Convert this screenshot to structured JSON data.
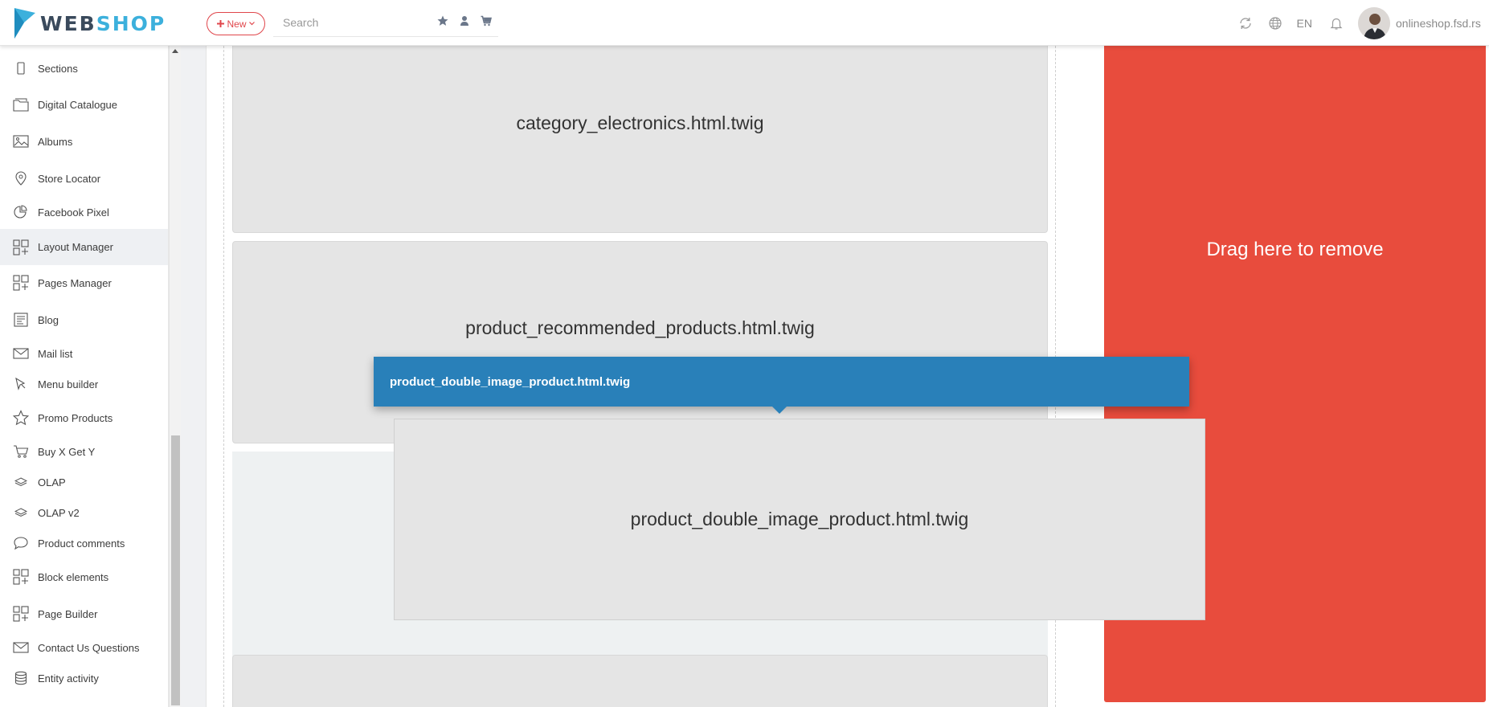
{
  "header": {
    "logo_web": "WEB",
    "logo_shop": "SHOP",
    "new_label": "New",
    "search_placeholder": "Search",
    "lang": "EN",
    "domain": "onlineshop.fsd.rs"
  },
  "sidebar": {
    "items": [
      {
        "label": "Sections",
        "icon": "mobile-icon"
      },
      {
        "label": "Digital Catalogue",
        "icon": "folder-icon"
      },
      {
        "label": "Albums",
        "icon": "image-icon"
      },
      {
        "label": "Store Locator",
        "icon": "map-pin-icon"
      },
      {
        "label": "Facebook Pixel",
        "icon": "pie-chart-icon"
      },
      {
        "label": "Layout Manager",
        "icon": "layout-icon"
      },
      {
        "label": "Pages Manager",
        "icon": "layout-icon"
      },
      {
        "label": "Blog",
        "icon": "blog-icon"
      },
      {
        "label": "Mail list",
        "icon": "mail-icon"
      },
      {
        "label": "Menu builder",
        "icon": "cursor-icon"
      },
      {
        "label": "Promo Products",
        "icon": "star-icon"
      },
      {
        "label": "Buy X Get Y",
        "icon": "cart-icon"
      },
      {
        "label": "OLAP",
        "icon": "layers-icon"
      },
      {
        "label": "OLAP v2",
        "icon": "layers-icon"
      },
      {
        "label": "Product comments",
        "icon": "comment-icon"
      },
      {
        "label": "Block elements",
        "icon": "layout-icon"
      },
      {
        "label": "Page Builder",
        "icon": "layout-icon"
      },
      {
        "label": "Contact Us Questions",
        "icon": "mail-icon"
      },
      {
        "label": "Entity activity",
        "icon": "database-icon"
      }
    ]
  },
  "layout": {
    "blocks": [
      "category_electronics.html.twig",
      "product_recommended_products.html.twig"
    ],
    "remove_zone_text": "Drag here to remove"
  },
  "drag": {
    "title": "product_double_image_product.html.twig",
    "block_label": "product_double_image_product.html.twig"
  },
  "colors": {
    "accent_blue": "#2980b9",
    "remove_red": "#e84c3d",
    "logo_blue": "#3cb0dc",
    "new_red": "#e0464b"
  }
}
